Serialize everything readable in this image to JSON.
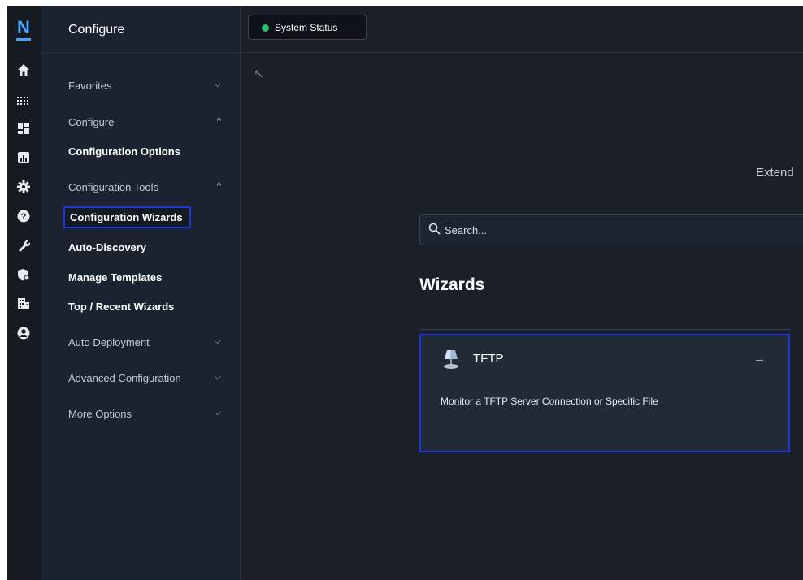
{
  "topbar": {
    "status_button": "System Status",
    "status_color": "#27c26a"
  },
  "sidebar": {
    "title": "Configure",
    "sections": [
      {
        "label": "Favorites",
        "expanded": false
      },
      {
        "label": "Configure",
        "expanded": true
      },
      {
        "label": "Configuration Tools",
        "expanded": true
      },
      {
        "label": "Auto Deployment",
        "expanded": false
      },
      {
        "label": "Advanced Configuration",
        "expanded": false
      },
      {
        "label": "More Options",
        "expanded": false
      }
    ],
    "items": {
      "configuration_options": "Configuration Options",
      "configuration_wizards": "Configuration Wizards",
      "auto_discovery": "Auto-Discovery",
      "manage_templates": "Manage Templates",
      "top_recent_wizards": "Top / Recent Wizards"
    }
  },
  "rail_icons": [
    "home-icon",
    "grid-icon",
    "dashboard-icon",
    "reports-icon",
    "gear-icon",
    "help-icon",
    "wrench-icon",
    "shield-icon",
    "building-icon",
    "user-icon"
  ],
  "main": {
    "extend_text": "Extend",
    "search_placeholder": "Search...",
    "section_title": "Wizards",
    "card": {
      "title": "TFTP",
      "description": "Monitor a TFTP Server Connection or Specific File"
    }
  },
  "colors": {
    "accent": "#4aa3ff",
    "highlight_border": "#1f36d6",
    "background": "#1b2028"
  }
}
